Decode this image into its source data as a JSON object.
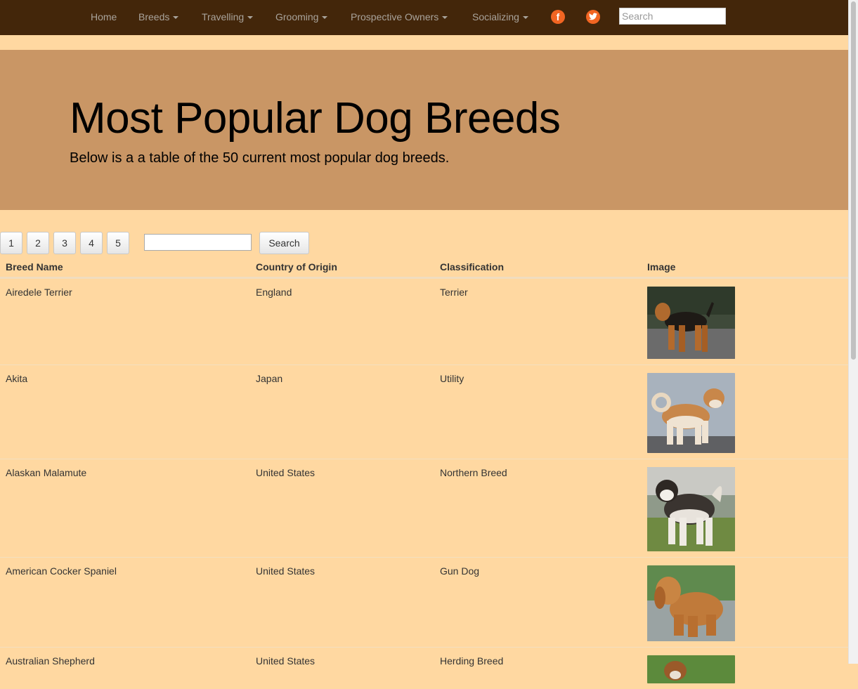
{
  "nav": {
    "items": [
      {
        "label": "Home",
        "dropdown": false
      },
      {
        "label": "Breeds",
        "dropdown": true
      },
      {
        "label": "Travelling",
        "dropdown": true
      },
      {
        "label": "Grooming",
        "dropdown": true
      },
      {
        "label": "Prospective Owners",
        "dropdown": true
      },
      {
        "label": "Socializing",
        "dropdown": true
      }
    ],
    "social": [
      {
        "name": "facebook-icon",
        "glyph": "f"
      },
      {
        "name": "twitter-icon",
        "glyph": "bird"
      }
    ],
    "search_placeholder": "Search"
  },
  "hero": {
    "title": "Most Popular Dog Breeds",
    "subtitle": "Below is a a table of the 50 current most popular dog breeds."
  },
  "controls": {
    "pages": [
      "1",
      "2",
      "3",
      "4",
      "5"
    ],
    "search_value": "",
    "search_button": "Search"
  },
  "table": {
    "headers": [
      "Breed Name",
      "Country of Origin",
      "Classification",
      "Image"
    ],
    "rows": [
      {
        "breed": "Airedele Terrier",
        "country": "England",
        "classification": "Terrier",
        "image": "airedale-terrier-photo"
      },
      {
        "breed": "Akita",
        "country": "Japan",
        "classification": "Utility",
        "image": "akita-photo"
      },
      {
        "breed": "Alaskan Malamute",
        "country": "United States",
        "classification": "Northern Breed",
        "image": "alaskan-malamute-photo"
      },
      {
        "breed": "American Cocker Spaniel",
        "country": "United States",
        "classification": "Gun Dog",
        "image": "american-cocker-spaniel-photo"
      },
      {
        "breed": "Australian Shepherd",
        "country": "United States",
        "classification": "Herding Breed",
        "image": "australian-shepherd-photo"
      }
    ]
  },
  "colors": {
    "navbar": "#43260a",
    "page_background": "#ffd8a1",
    "hero_background": "#c99665",
    "social_icon": "#f26522",
    "nav_text": "#a9a39b"
  }
}
